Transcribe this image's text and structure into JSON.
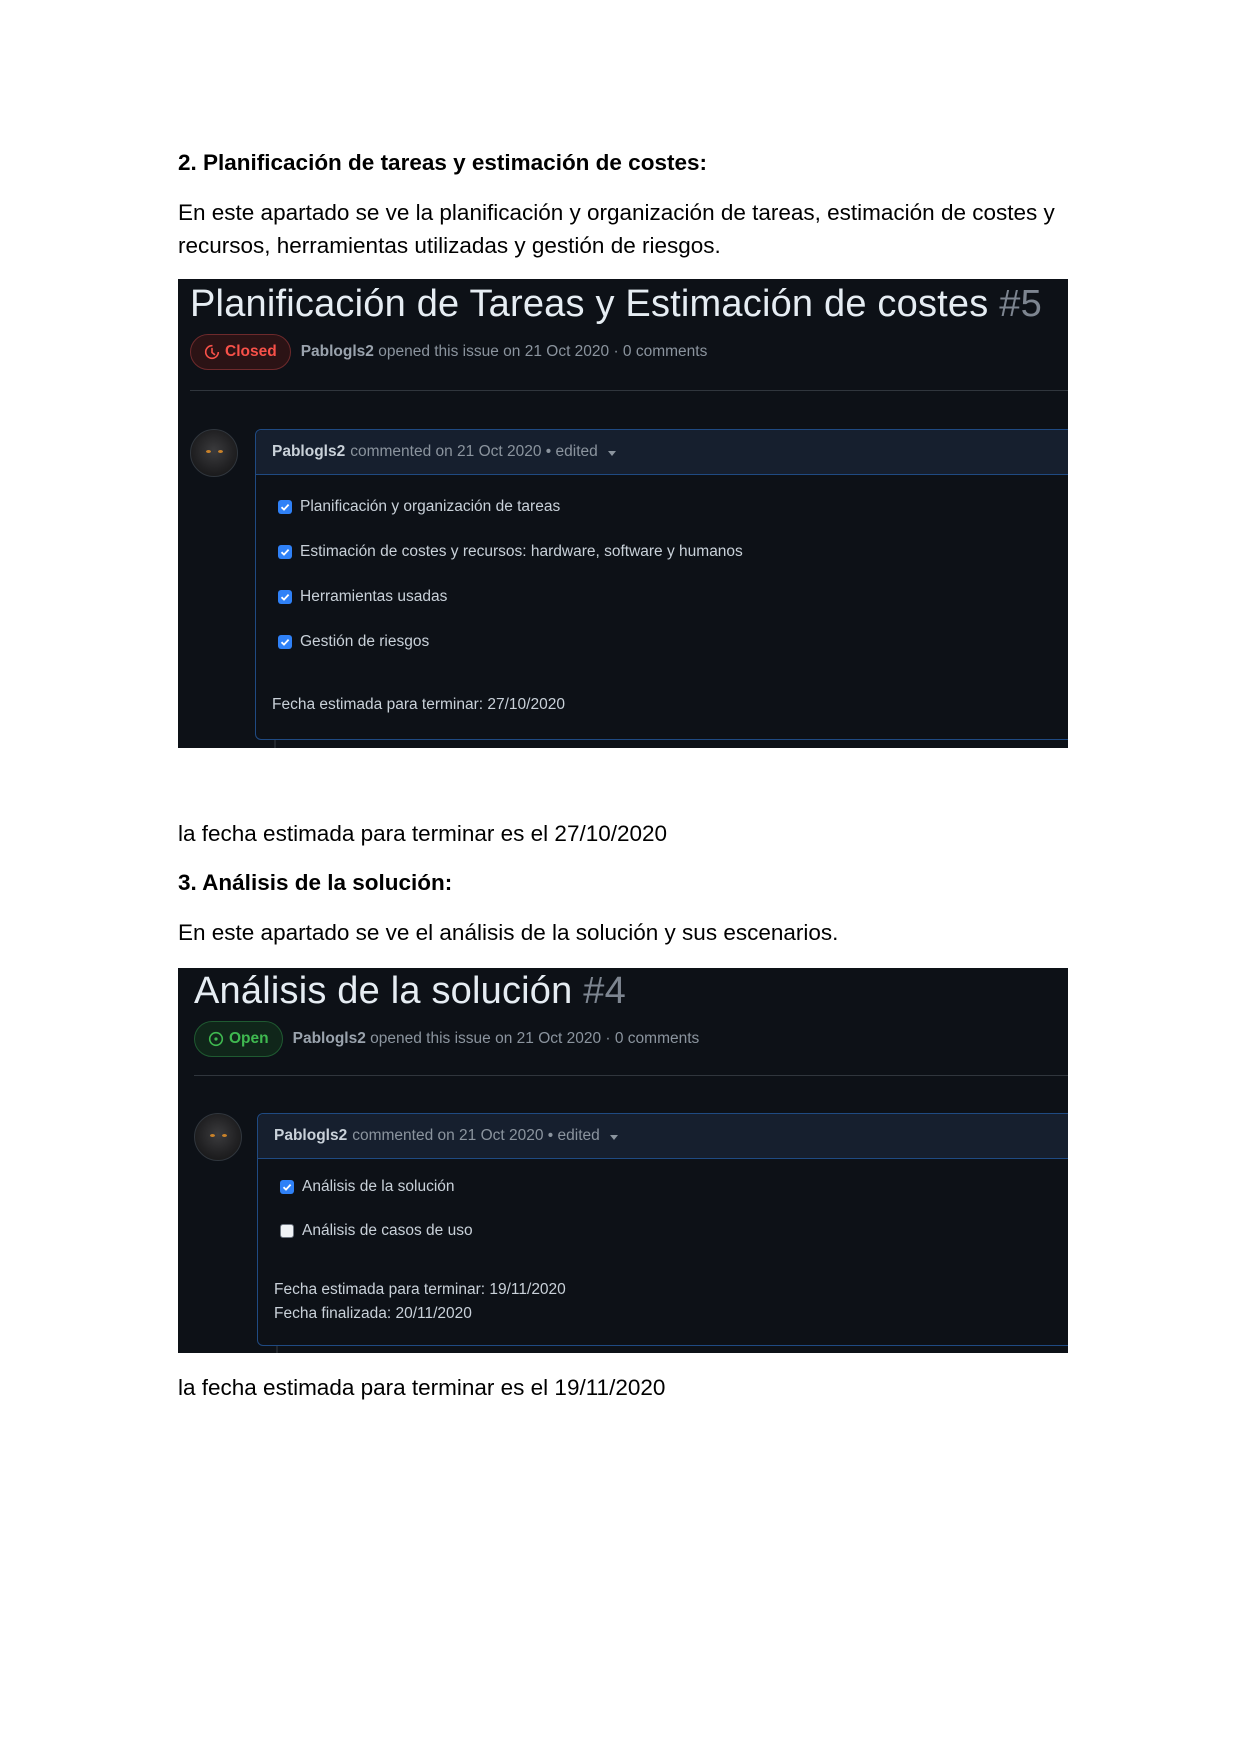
{
  "section2": {
    "heading": "2. Planificación de tareas y estimación de costes:",
    "intro_line1": "En este apartado se ve la planificación y organización de tareas, estimación de costes y",
    "intro_line2": "recursos, herramientas utilizadas y gestión de riesgos.",
    "screenshot": {
      "title": "Planificación de Tareas y Estimación de costes",
      "number": "#5",
      "state": "Closed",
      "author": "Pablogls2",
      "meta": "opened this issue on 21 Oct 2020 · 0 comments",
      "comment_author": "Pablogls2",
      "comment_meta": "commented on 21 Oct 2020 • edited",
      "tasks": [
        {
          "label": "Planificación y organización de tareas",
          "checked": true
        },
        {
          "label": "Estimación de costes y recursos: hardware, software y humanos",
          "checked": true
        },
        {
          "label": "Herramientas usadas",
          "checked": true
        },
        {
          "label": "Gestión de riesgos",
          "checked": true
        }
      ],
      "note1": "Fecha estimada para terminar: 27/10/2020"
    },
    "after": "la fecha estimada para terminar es el 27/10/2020"
  },
  "section3": {
    "heading": "3. Análisis de la solución:",
    "intro": "En este apartado se ve el análisis de la solución y sus escenarios.",
    "screenshot": {
      "title": "Análisis de la solución",
      "number": "#4",
      "state": "Open",
      "author": "Pablogls2",
      "meta": "opened this issue on 21 Oct 2020 · 0 comments",
      "comment_author": "Pablogls2",
      "comment_meta": "commented on 21 Oct 2020 • edited",
      "tasks": [
        {
          "label": "Análisis de la solución",
          "checked": true
        },
        {
          "label": "Análisis de casos de uso",
          "checked": false
        }
      ],
      "note1": "Fecha estimada para terminar: 19/11/2020",
      "note2": "Fecha finalizada: 20/11/2020"
    },
    "after": "la fecha estimada para terminar es el 19/11/2020"
  },
  "colors": {
    "screenshot_bg": "#0d1117",
    "closed": "#f85149",
    "open": "#3fb950",
    "checkbox": "#2f81f7"
  }
}
